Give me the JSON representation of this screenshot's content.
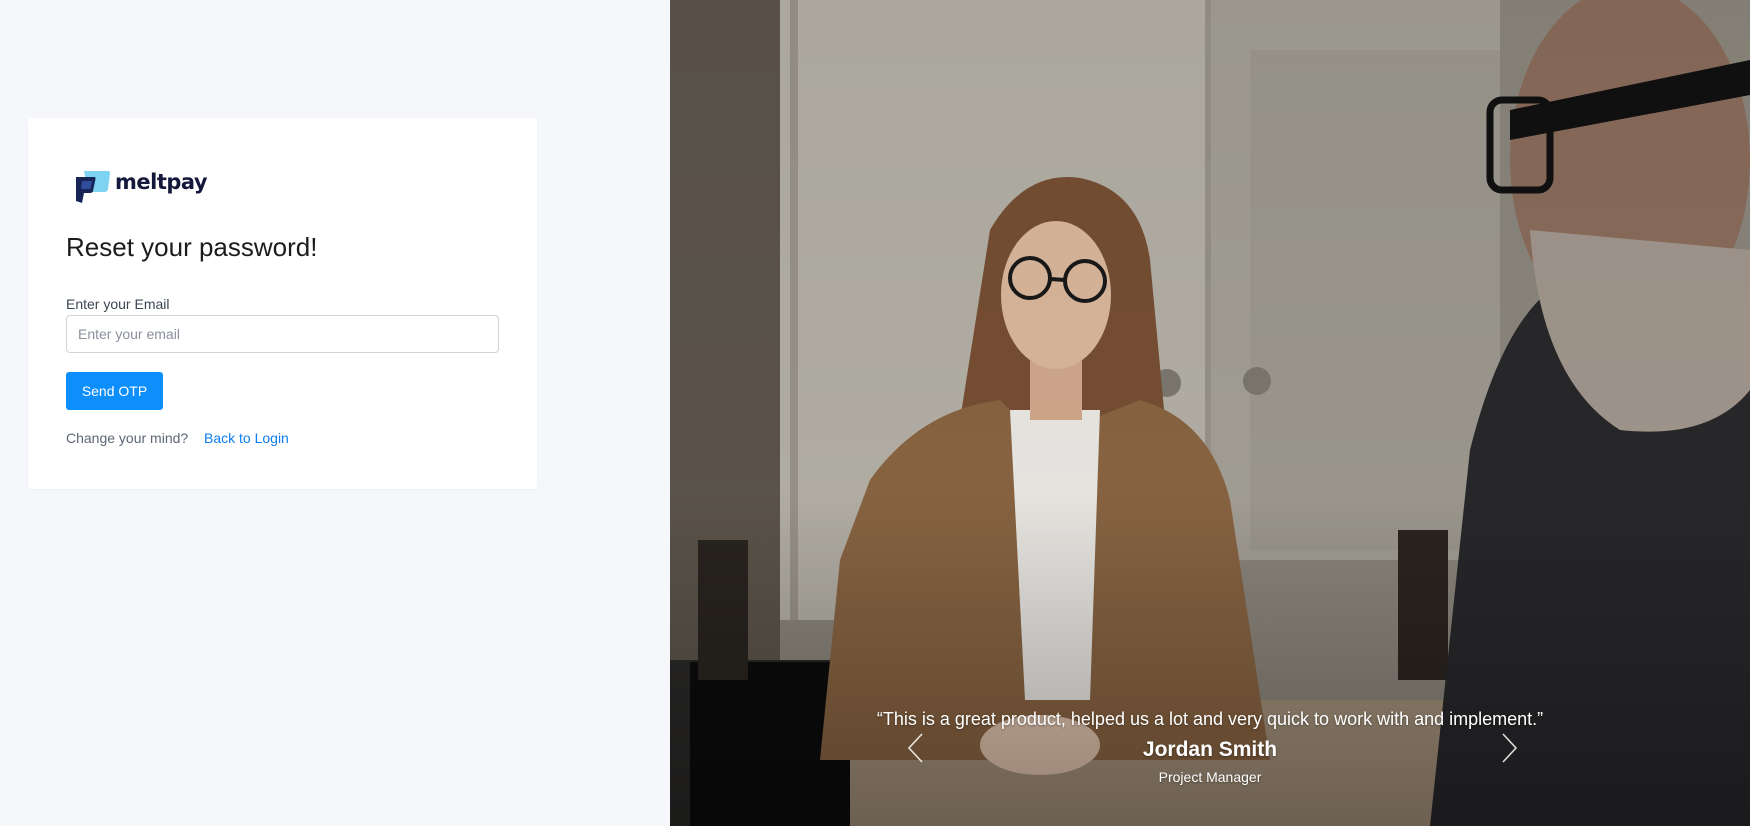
{
  "brand": {
    "name": "meltpay"
  },
  "form": {
    "title": "Reset your password!",
    "email_label": "Enter your Email",
    "email_placeholder": "Enter your email",
    "email_value": "",
    "submit_label": "Send OTP",
    "change_mind_text": "Change your mind?",
    "back_to_login_label": "Back to Login"
  },
  "testimonial": {
    "quote": "“This is a great product, helped us a lot and very quick to work with and implement.”",
    "author": "Jordan Smith",
    "role": "Project Manager"
  },
  "icons": {
    "logo": "meltpay-logo-icon",
    "prev": "chevron-left-icon",
    "next": "chevron-right-icon"
  },
  "colors": {
    "primary": "#0d8efd",
    "link": "#0d7ef2",
    "page_background": "#f5f7fb",
    "card_background": "#ffffff",
    "brand_text": "#14183a"
  }
}
